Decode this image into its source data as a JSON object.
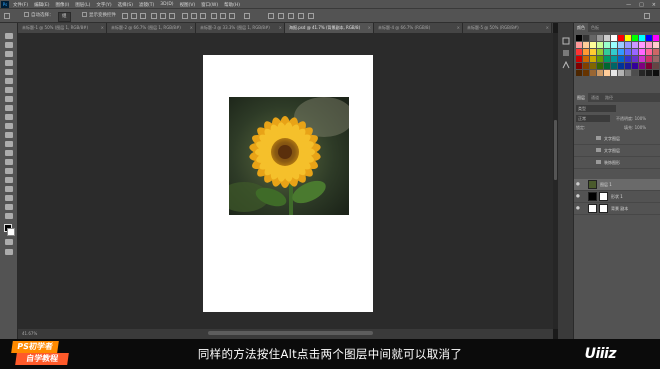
{
  "app": {
    "logo": "Ps"
  },
  "menubar": {
    "items": [
      "文件(F)",
      "编辑(E)",
      "图像(I)",
      "图层(L)",
      "文字(Y)",
      "选择(S)",
      "滤镜(T)",
      "3D(D)",
      "视图(V)",
      "窗口(W)",
      "帮助(H)"
    ],
    "minimize": "—",
    "maximize": "□",
    "close": "×"
  },
  "options": {
    "auto_select_label": "自动选择：",
    "auto_select_value": "组",
    "transform_controls_label": "显示变换控件"
  },
  "tabs": [
    {
      "label": "未标题-1 @ 50% (图层 1, RGB/8#)",
      "active": false
    },
    {
      "label": "未标题-2 @ 66.7% (图层 1, RGB/8#)",
      "active": false
    },
    {
      "label": "未标题-3 @ 33.3% (图层 1, RGB/8#)",
      "active": false
    },
    {
      "label": "海报.psd @ 41.7% (背景副本, RGB/8)",
      "active": true
    },
    {
      "label": "未标题-4 @ 66.7% (RGB/8)",
      "active": false
    },
    {
      "label": "未标题-5 @ 50% (RGB/8#)",
      "active": false
    }
  ],
  "status": {
    "zoom": "41.67%"
  },
  "panels": {
    "top_tabs": [
      "颜色",
      "色板"
    ],
    "mid_tabs": [
      "图层",
      "通道",
      "路径"
    ],
    "kind_label": "类型",
    "blend_mode": "正常",
    "opacity_label": "不透明度:",
    "opacity_value": "100%",
    "lock_label": "锁定:",
    "fill_label": "填充:",
    "fill_value": "100%",
    "layers": [
      {
        "name": "文字图层",
        "type": "folder",
        "visible": false,
        "selected": false
      },
      {
        "name": "文字图层",
        "type": "folder",
        "visible": false,
        "selected": false
      },
      {
        "name": "装饰图形",
        "type": "folder",
        "visible": false,
        "selected": false
      },
      {
        "name": "图层 1",
        "type": "image",
        "visible": true,
        "selected": true
      },
      {
        "name": "形状 1",
        "type": "shape",
        "visible": true,
        "selected": false
      },
      {
        "name": "背景 副本",
        "type": "layer",
        "visible": true,
        "selected": false
      }
    ],
    "swatch_colors": [
      "#000000",
      "#333333",
      "#666666",
      "#999999",
      "#cccccc",
      "#ffffff",
      "#ff0000",
      "#ffff00",
      "#00ff00",
      "#00ffff",
      "#0000ff",
      "#ff00ff",
      "#ff9999",
      "#ffcc99",
      "#ffff99",
      "#ccff99",
      "#99ffcc",
      "#99ffff",
      "#99ccff",
      "#9999ff",
      "#cc99ff",
      "#ff99ff",
      "#ff99cc",
      "#ffcccc",
      "#ff3333",
      "#ff9933",
      "#ffcc33",
      "#99cc33",
      "#33cc99",
      "#33cccc",
      "#3399ff",
      "#6666ff",
      "#9966ff",
      "#ff66ff",
      "#ff6699",
      "#cc6666",
      "#cc0000",
      "#cc6600",
      "#ccaa00",
      "#669900",
      "#009966",
      "#009999",
      "#0066cc",
      "#3333cc",
      "#6633cc",
      "#cc33cc",
      "#cc3366",
      "#996666",
      "#800000",
      "#804000",
      "#806600",
      "#336600",
      "#006633",
      "#006666",
      "#003399",
      "#1a1a99",
      "#330099",
      "#800080",
      "#800033",
      "#664444",
      "#4d2600",
      "#663300",
      "#996633",
      "#cc9966",
      "#ffcc99",
      "#e6e6e6",
      "#b3b3b3",
      "#808080",
      "#4d4d4d",
      "#262626",
      "#1a1a1a",
      "#0d0d0d"
    ]
  },
  "caption": {
    "text": "同样的方法按住Alt点击两个图层中间就可以取消了",
    "badge_line1": "PS初学者",
    "badge_line2": "自学教程",
    "logo": "Uiiiz"
  },
  "colors": {
    "ui_bg": "#535353",
    "canvas_bg": "#2b2b2b",
    "document": "#ffffff",
    "caption_bg": "#0b0b0b"
  }
}
